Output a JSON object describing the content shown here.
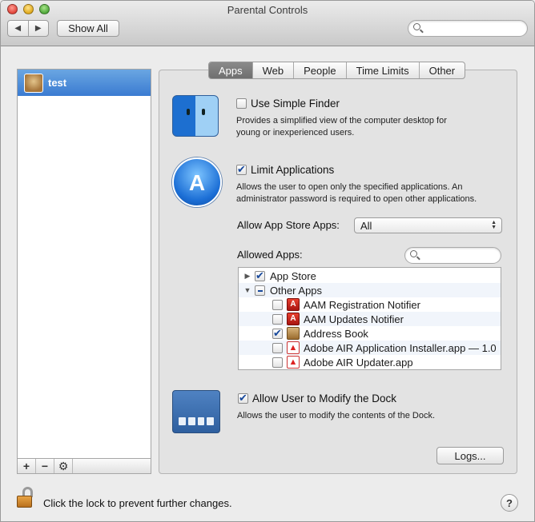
{
  "window": {
    "title": "Parental Controls"
  },
  "toolbar": {
    "back_glyph": "◀",
    "forward_glyph": "▶",
    "show_all_label": "Show All",
    "search_placeholder": ""
  },
  "users": [
    {
      "name": "test",
      "selected": true
    }
  ],
  "list_tools": {
    "add": "+",
    "remove": "−",
    "action": "⚙"
  },
  "tabs": [
    {
      "label": "Apps",
      "active": true
    },
    {
      "label": "Web",
      "active": false
    },
    {
      "label": "People",
      "active": false
    },
    {
      "label": "Time Limits",
      "active": false
    },
    {
      "label": "Other",
      "active": false
    }
  ],
  "simple_finder": {
    "label": "Use Simple Finder",
    "checked": false,
    "description_line1": "Provides a simplified view of the computer desktop for",
    "description_line2": "young or inexperienced users."
  },
  "limit_apps": {
    "label": "Limit Applications",
    "checked": true,
    "description_line1": "Allows the user to open only the specified applications. An",
    "description_line2": "administrator password is required to open other applications.",
    "app_store_label": "Allow App Store Apps:",
    "app_store_value": "All",
    "allowed_apps_label": "Allowed Apps:",
    "allowed_search_placeholder": ""
  },
  "allowed_apps": [
    {
      "name": "App Store",
      "checked": "on",
      "disclosure": "▶",
      "level": 0,
      "icon": "app-store-icon"
    },
    {
      "name": "Other Apps",
      "checked": "mixed",
      "disclosure": "▼",
      "level": 0,
      "icon": ""
    },
    {
      "name": "AAM Registration Notifier",
      "checked": "off",
      "disclosure": "",
      "level": 1,
      "icon": "adobe-icon"
    },
    {
      "name": "AAM Updates Notifier",
      "checked": "off",
      "disclosure": "",
      "level": 1,
      "icon": "adobe-icon"
    },
    {
      "name": "Address Book",
      "checked": "on",
      "disclosure": "",
      "level": 1,
      "icon": "address-book-icon"
    },
    {
      "name": "Adobe AIR Application Installer.app — 1.0",
      "checked": "off",
      "disclosure": "",
      "level": 1,
      "icon": "adobe-air-icon"
    },
    {
      "name": "Adobe AIR Updater.app",
      "checked": "off",
      "disclosure": "",
      "level": 1,
      "icon": "adobe-air-icon"
    }
  ],
  "dock": {
    "label": "Allow User to Modify the Dock",
    "checked": true,
    "description": "Allows the user to modify the contents of the Dock."
  },
  "logs_label": "Logs...",
  "lock_text": "Click the lock to prevent further changes.",
  "help_label": "?"
}
